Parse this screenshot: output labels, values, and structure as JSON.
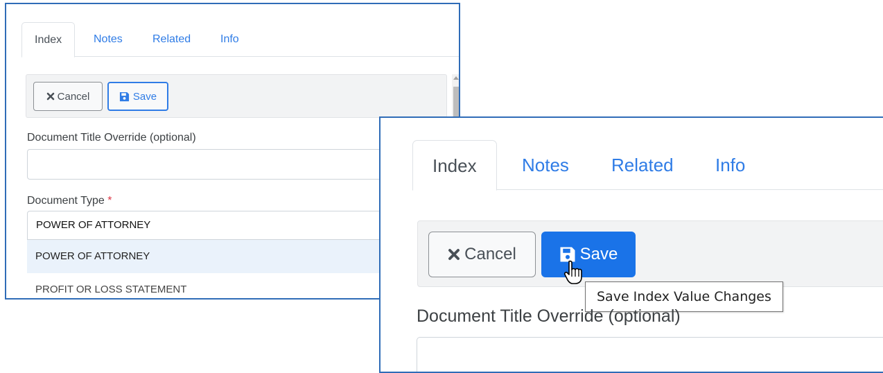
{
  "colors": {
    "accent": "#2f7ce6",
    "save_active": "#1a73e8",
    "required": "#dc3545",
    "frame": "#2f6cb7"
  },
  "panel_small": {
    "tabs": [
      {
        "label": "Index",
        "active": true
      },
      {
        "label": "Notes",
        "active": false
      },
      {
        "label": "Related",
        "active": false
      },
      {
        "label": "Info",
        "active": false
      }
    ],
    "toolbar": {
      "cancel_label": "Cancel",
      "cancel_icon": "times-icon",
      "save_label": "Save",
      "save_icon": "floppy-disk-icon"
    },
    "title_override": {
      "label": "Document Title Override (optional)",
      "value": ""
    },
    "document_type": {
      "label": "Document Type",
      "required_mark": "*",
      "value": "POWER OF ATTORNEY",
      "options": [
        {
          "label": "POWER OF ATTORNEY",
          "highlighted": true
        },
        {
          "label": "PROFIT OR LOSS STATEMENT",
          "highlighted": false
        }
      ]
    }
  },
  "panel_zoom": {
    "tabs": [
      {
        "label": "Index",
        "active": true
      },
      {
        "label": "Notes",
        "active": false
      },
      {
        "label": "Related",
        "active": false
      },
      {
        "label": "Info",
        "active": false
      }
    ],
    "toolbar": {
      "cancel_label": "Cancel",
      "cancel_icon": "times-icon",
      "save_label": "Save",
      "save_icon": "floppy-disk-icon",
      "save_state": "hover"
    },
    "tooltip": "Save Index Value Changes",
    "cursor_icon": "hand-pointer-icon",
    "title_override": {
      "label": "Document Title Override (optional)",
      "value": ""
    }
  }
}
